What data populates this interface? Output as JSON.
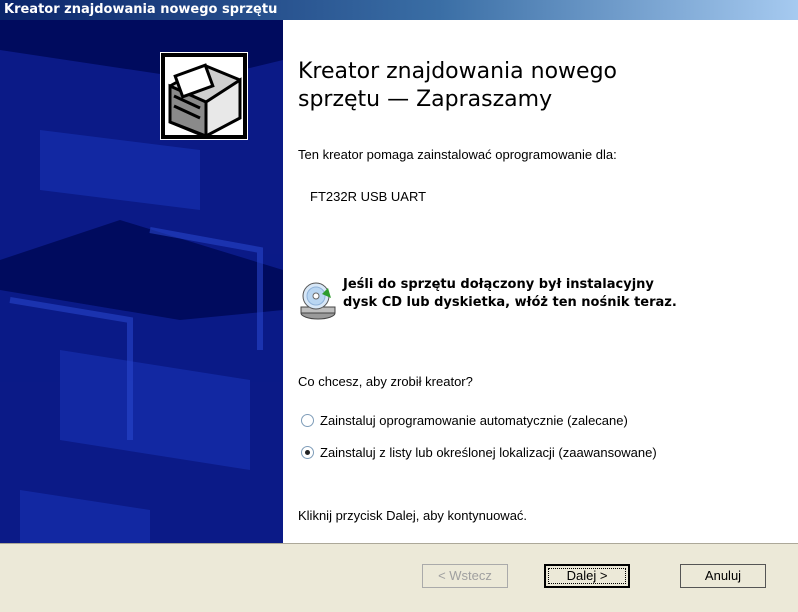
{
  "window": {
    "title": "Kreator znajdowania nowego sprzętu"
  },
  "content": {
    "heading_line1": "Kreator znajdowania nowego",
    "heading_line2": "sprzętu — Zapraszamy",
    "intro": "Ten kreator pomaga zainstalować oprogramowanie dla:",
    "device_name": "FT232R USB UART",
    "cd_line1": "Jeśli do sprzętu dołączony był instalacyjny",
    "cd_line2": "dysk CD lub dyskietka, włóż ten nośnik teraz.",
    "question": "Co chcesz, aby zrobił kreator?",
    "options": [
      {
        "label": "Zainstaluj oprogramowanie automatycznie (zalecane)",
        "checked": false
      },
      {
        "label": "Zainstaluj z listy lub określonej lokalizacji (zaawansowane)",
        "checked": true
      }
    ],
    "footer_hint": "Kliknij przycisk Dalej, aby kontynuować."
  },
  "buttons": {
    "back": "< Wstecz",
    "next": "Dalej >",
    "cancel": "Anuluj"
  },
  "colors": {
    "sidebar": "#000b5e",
    "title_start": "#0a246a",
    "face": "#ece9d8"
  }
}
